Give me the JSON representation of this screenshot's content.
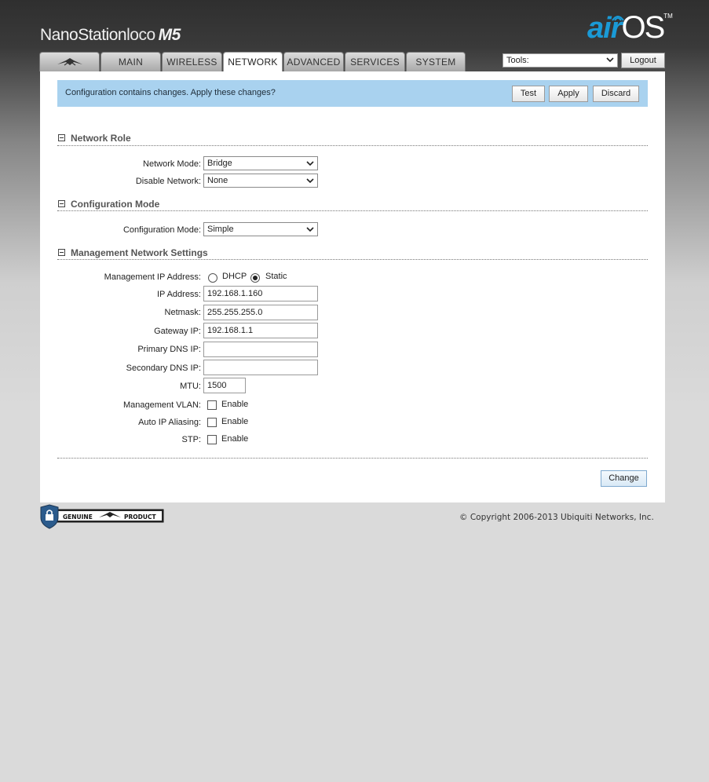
{
  "header": {
    "product_name_bold": "NanoStation",
    "product_name_thin": "loco",
    "product_model": "M5",
    "os_logo_air": "air",
    "os_logo_os": "OS",
    "os_logo_tm": "TM"
  },
  "tabs": [
    {
      "label": "",
      "icon": "ubiquiti-logo-icon"
    },
    {
      "label": "MAIN"
    },
    {
      "label": "WIRELESS"
    },
    {
      "label": "NETWORK",
      "active": true
    },
    {
      "label": "ADVANCED"
    },
    {
      "label": "SERVICES"
    },
    {
      "label": "SYSTEM"
    }
  ],
  "tools": {
    "selected": "Tools:",
    "logout_label": "Logout"
  },
  "notice": {
    "text": "Configuration contains changes. Apply these changes?",
    "test_label": "Test",
    "apply_label": "Apply",
    "discard_label": "Discard",
    "bg_color": "#a9d2ef"
  },
  "network_role": {
    "title": "Network Role",
    "network_mode_label": "Network Mode:",
    "network_mode_value": "Bridge",
    "disable_network_label": "Disable Network:",
    "disable_network_value": "None"
  },
  "configuration_mode": {
    "title": "Configuration Mode",
    "label": "Configuration Mode:",
    "value": "Simple"
  },
  "management": {
    "title": "Management Network Settings",
    "ip_address_mode_label": "Management IP Address:",
    "dhcp_label": "DHCP",
    "static_label": "Static",
    "selected_mode": "Static",
    "ip_label": "IP Address:",
    "ip_value": "192.168.1.160",
    "netmask_label": "Netmask:",
    "netmask_value": "255.255.255.0",
    "gateway_label": "Gateway IP:",
    "gateway_value": "192.168.1.1",
    "primary_dns_label": "Primary DNS IP:",
    "primary_dns_value": "",
    "secondary_dns_label": "Secondary DNS IP:",
    "secondary_dns_value": "",
    "mtu_label": "MTU:",
    "mtu_value": "1500",
    "vlan_label": "Management VLAN:",
    "auto_alias_label": "Auto IP Aliasing:",
    "stp_label": "STP:",
    "enable_label": "Enable"
  },
  "footer": {
    "change_label": "Change",
    "copyright": "© Copyright 2006-2013 Ubiquiti Networks, Inc.",
    "badge_left": "GENUINE",
    "badge_right": "PRODUCT"
  }
}
